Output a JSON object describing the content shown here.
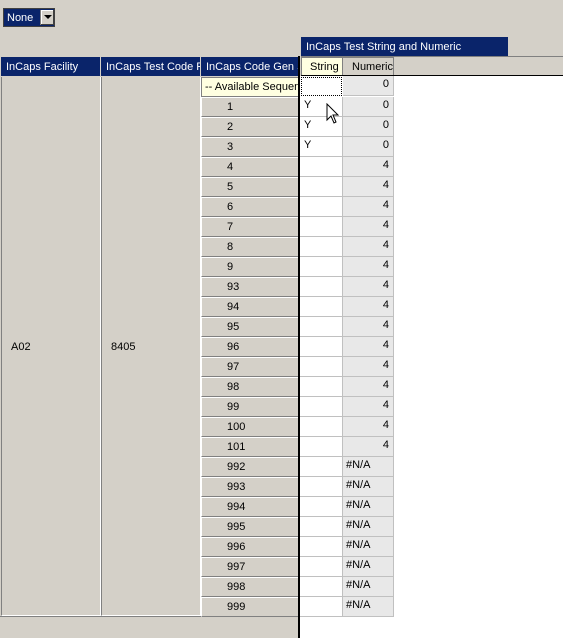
{
  "filter": {
    "value": "None",
    "icon": "dropdown-arrow-icon"
  },
  "headers": {
    "facility": "InCaps Facility",
    "test_code": "InCaps Test Code F",
    "code_gen": "InCaps Code Gen S",
    "group": "InCaps Test String and Numeric",
    "string_col": "String",
    "numeric_col": "Numeric"
  },
  "facility_value": "A02",
  "test_code_value": "8405",
  "available_row_label": "-- Available Sequen",
  "rows": [
    {
      "seq": "1",
      "string": "Y",
      "numeric": "0"
    },
    {
      "seq": "2",
      "string": "Y",
      "numeric": "0"
    },
    {
      "seq": "3",
      "string": "Y",
      "numeric": "0"
    },
    {
      "seq": "4",
      "string": "",
      "numeric": "4"
    },
    {
      "seq": "5",
      "string": "",
      "numeric": "4"
    },
    {
      "seq": "6",
      "string": "",
      "numeric": "4"
    },
    {
      "seq": "7",
      "string": "",
      "numeric": "4"
    },
    {
      "seq": "8",
      "string": "",
      "numeric": "4"
    },
    {
      "seq": "9",
      "string": "",
      "numeric": "4"
    },
    {
      "seq": "93",
      "string": "",
      "numeric": "4"
    },
    {
      "seq": "94",
      "string": "",
      "numeric": "4"
    },
    {
      "seq": "95",
      "string": "",
      "numeric": "4"
    },
    {
      "seq": "96",
      "string": "",
      "numeric": "4"
    },
    {
      "seq": "97",
      "string": "",
      "numeric": "4"
    },
    {
      "seq": "98",
      "string": "",
      "numeric": "4"
    },
    {
      "seq": "99",
      "string": "",
      "numeric": "4"
    },
    {
      "seq": "100",
      "string": "",
      "numeric": "4"
    },
    {
      "seq": "101",
      "string": "",
      "numeric": "4"
    },
    {
      "seq": "992",
      "string": "",
      "numeric": "#N/A"
    },
    {
      "seq": "993",
      "string": "",
      "numeric": "#N/A"
    },
    {
      "seq": "994",
      "string": "",
      "numeric": "#N/A"
    },
    {
      "seq": "995",
      "string": "",
      "numeric": "#N/A"
    },
    {
      "seq": "996",
      "string": "",
      "numeric": "#N/A"
    },
    {
      "seq": "997",
      "string": "",
      "numeric": "#N/A"
    },
    {
      "seq": "998",
      "string": "",
      "numeric": "#N/A"
    },
    {
      "seq": "999",
      "string": "",
      "numeric": "#N/A"
    }
  ],
  "available_row_numeric": "0"
}
